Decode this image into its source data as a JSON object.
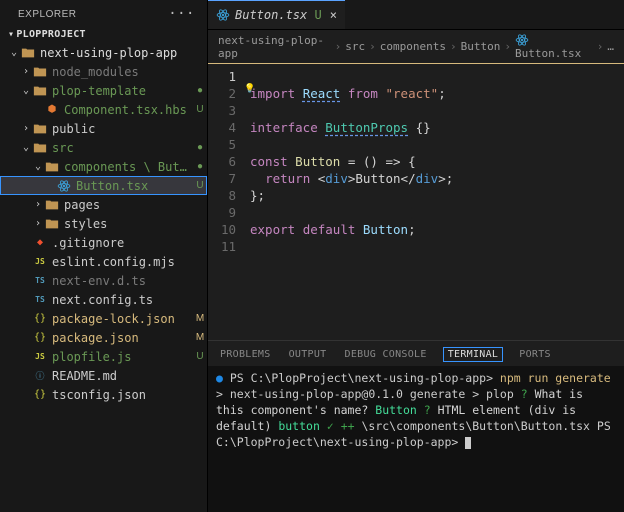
{
  "sidebar": {
    "title": "EXPLORER",
    "section": "PLOPPROJECT",
    "tree": [
      {
        "depth": 0,
        "chev": "v",
        "icon": "folder",
        "label": "next-using-plop-app",
        "color": "#ddd",
        "status": "",
        "statusClass": ""
      },
      {
        "depth": 1,
        "chev": ">",
        "icon": "folder",
        "label": "node_modules",
        "color": "#7a7a7a",
        "status": "",
        "statusClass": ""
      },
      {
        "depth": 1,
        "chev": "v",
        "icon": "folder",
        "label": "plop-template",
        "color": "#6a9955",
        "status": "●",
        "statusClass": ""
      },
      {
        "depth": 2,
        "chev": "",
        "icon": "hbs",
        "label": "Component.tsx.hbs",
        "color": "#6a9955",
        "status": "U",
        "statusClass": ""
      },
      {
        "depth": 1,
        "chev": ">",
        "icon": "folder",
        "label": "public",
        "color": "#ccc",
        "status": "",
        "statusClass": ""
      },
      {
        "depth": 1,
        "chev": "v",
        "icon": "folder",
        "label": "src",
        "color": "#6a9955",
        "status": "●",
        "statusClass": ""
      },
      {
        "depth": 2,
        "chev": "v",
        "icon": "folder",
        "label": "components \\ Button",
        "color": "#6a9955",
        "status": "●",
        "statusClass": ""
      },
      {
        "depth": 3,
        "chev": "",
        "icon": "react",
        "label": "Button.tsx",
        "color": "#6a9955",
        "status": "U",
        "statusClass": "",
        "active": true
      },
      {
        "depth": 2,
        "chev": ">",
        "icon": "folder",
        "label": "pages",
        "color": "#ccc",
        "status": "",
        "statusClass": ""
      },
      {
        "depth": 2,
        "chev": ">",
        "icon": "folder",
        "label": "styles",
        "color": "#ccc",
        "status": "",
        "statusClass": ""
      },
      {
        "depth": 1,
        "chev": "",
        "icon": "git",
        "label": ".gitignore",
        "color": "#ccc",
        "status": "",
        "statusClass": ""
      },
      {
        "depth": 1,
        "chev": "",
        "icon": "js",
        "label": "eslint.config.mjs",
        "color": "#ccc",
        "status": "",
        "statusClass": ""
      },
      {
        "depth": 1,
        "chev": "",
        "icon": "ts",
        "label": "next-env.d.ts",
        "color": "#7a7a7a",
        "status": "",
        "statusClass": ""
      },
      {
        "depth": 1,
        "chev": "",
        "icon": "ts",
        "label": "next.config.ts",
        "color": "#ccc",
        "status": "",
        "statusClass": ""
      },
      {
        "depth": 1,
        "chev": "",
        "icon": "json",
        "label": "package-lock.json",
        "color": "#d7ba7d",
        "status": "M",
        "statusClass": "m"
      },
      {
        "depth": 1,
        "chev": "",
        "icon": "json",
        "label": "package.json",
        "color": "#d7ba7d",
        "status": "M",
        "statusClass": "m"
      },
      {
        "depth": 1,
        "chev": "",
        "icon": "js",
        "label": "plopfile.js",
        "color": "#6a9955",
        "status": "U",
        "statusClass": ""
      },
      {
        "depth": 1,
        "chev": "",
        "icon": "md",
        "label": "README.md",
        "color": "#ccc",
        "status": "",
        "statusClass": ""
      },
      {
        "depth": 1,
        "chev": "",
        "icon": "json",
        "label": "tsconfig.json",
        "color": "#ccc",
        "status": "",
        "statusClass": ""
      }
    ]
  },
  "tab": {
    "label": "Button.tsx",
    "status": "U"
  },
  "breadcrumb": [
    "next-using-plop-app",
    "src",
    "components",
    "Button",
    "Button.tsx",
    "…"
  ],
  "code": {
    "lines": 11
  },
  "termTabs": [
    "PROBLEMS",
    "OUTPUT",
    "DEBUG CONSOLE",
    "TERMINAL",
    "PORTS"
  ],
  "terminal": {
    "prompt1_path": "C:\\PlopProject\\next-using-plop-app",
    "prompt1_cmd": "npm run generate",
    "line_pkg": "next-using-plop-app@0.1.0 generate",
    "line_plop": "plop",
    "q1": "What is this component's name?",
    "a1": "Button",
    "q2": "HTML element (div is default)",
    "a2": "button",
    "added": "\\src\\components\\Button\\Button.tsx",
    "prompt2_path": "C:\\PlopProject\\next-using-plop-app"
  }
}
